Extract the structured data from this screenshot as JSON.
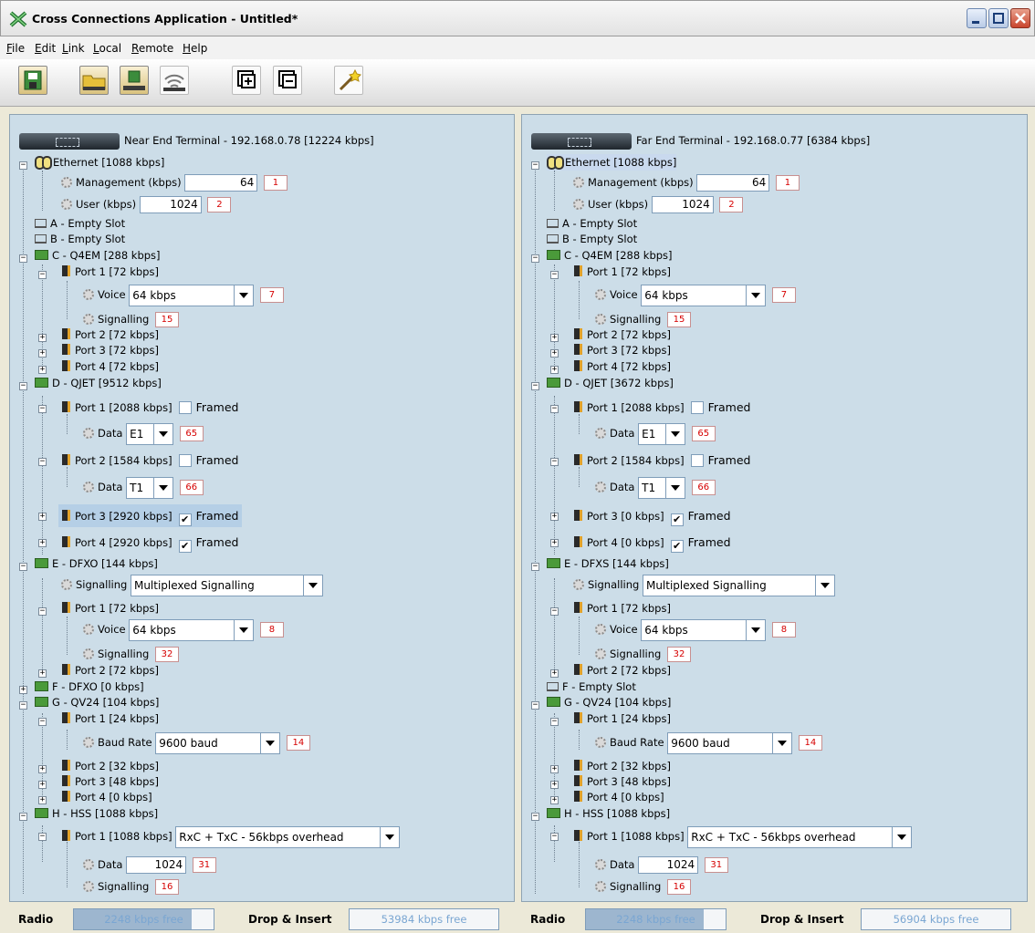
{
  "window": {
    "title": "Cross Connections Application - Untitled*"
  },
  "menu": [
    "File",
    "Edit",
    "Link",
    "Local",
    "Remote",
    "Help"
  ],
  "toolbar": {
    "icons": [
      "save-icon",
      "open-folder-icon",
      "download-icon",
      "antenna-icon",
      "expand-all-icon",
      "collapse-all-icon",
      "wizard-wand-icon"
    ]
  },
  "near": {
    "header": "Near End Terminal - 192.168.0.78 [12224 kbps]",
    "ethernet": "Ethernet [1088 kbps]",
    "mgmt_label": "Management (kbps)",
    "mgmt_value": "64",
    "mgmt_tag": "1",
    "user_label": "User (kbps)",
    "user_value": "1024",
    "user_tag": "2",
    "slot_a": "A - Empty Slot",
    "slot_b": "B - Empty Slot",
    "c_card": "C - Q4EM [288 kbps]",
    "c_p1": "Port 1 [72 kbps]",
    "c_voice": "Voice",
    "c_voice_val": "64 kbps",
    "c_voice_tag": "7",
    "c_sig": "Signalling",
    "c_sig_tag": "15",
    "c_p2": "Port 2 [72 kbps]",
    "c_p3": "Port 3 [72 kbps]",
    "c_p4": "Port 4 [72 kbps]",
    "d_card": "D - QJET [9512 kbps]",
    "d_p1": "Port 1 [2088 kbps]",
    "framed": "Framed",
    "data": "Data",
    "d_p1_val": "E1",
    "d_p1_tag": "65",
    "d_p2": "Port 2 [1584 kbps]",
    "d_p2_val": "T1",
    "d_p2_tag": "66",
    "d_p3": "Port 3 [2920 kbps]",
    "d_p4": "Port 4 [2920 kbps]",
    "e_card": "E - DFXO [144 kbps]",
    "e_sig": "Signalling",
    "e_sig_val": "Multiplexed Signalling",
    "e_p1": "Port 1 [72 kbps]",
    "e_voice": "Voice",
    "e_voice_val": "64 kbps",
    "e_voice_tag": "8",
    "e_p1sig": "Signalling",
    "e_p1sig_tag": "32",
    "e_p2": "Port 2 [72 kbps]",
    "f_card": "F - DFXO [0 kbps]",
    "g_card": "G - QV24 [104 kbps]",
    "g_p1": "Port 1 [24 kbps]",
    "g_baud": "Baud Rate",
    "g_baud_val": "9600 baud",
    "g_baud_tag": "14",
    "g_p2": "Port 2 [32 kbps]",
    "g_p3": "Port 3 [48 kbps]",
    "g_p4": "Port 4 [0 kbps]",
    "h_card": "H - HSS [1088 kbps]",
    "h_p1": "Port 1 [1088 kbps]",
    "h_p1_val": "RxC + TxC - 56kbps overhead",
    "h_data": "Data",
    "h_data_val": "1024",
    "h_data_tag": "31",
    "h_sig": "Signalling",
    "h_sig_tag": "16"
  },
  "far": {
    "header": "Far End Terminal - 192.168.0.77 [6384 kbps]",
    "ethernet": "Ethernet [1088 kbps]",
    "mgmt_label": "Management (kbps)",
    "mgmt_value": "64",
    "mgmt_tag": "1",
    "user_label": "User (kbps)",
    "user_value": "1024",
    "user_tag": "2",
    "slot_a": "A - Empty Slot",
    "slot_b": "B - Empty Slot",
    "c_card": "C - Q4EM [288 kbps]",
    "c_p1": "Port 1 [72 kbps]",
    "c_voice": "Voice",
    "c_voice_val": "64 kbps",
    "c_voice_tag": "7",
    "c_sig": "Signalling",
    "c_sig_tag": "15",
    "c_p2": "Port 2 [72 kbps]",
    "c_p3": "Port 3 [72 kbps]",
    "c_p4": "Port 4 [72 kbps]",
    "d_card": "D - QJET [3672 kbps]",
    "d_p1": "Port 1 [2088 kbps]",
    "framed": "Framed",
    "data": "Data",
    "d_p1_val": "E1",
    "d_p1_tag": "65",
    "d_p2": "Port 2 [1584 kbps]",
    "d_p2_val": "T1",
    "d_p2_tag": "66",
    "d_p3": "Port 3 [0 kbps]",
    "d_p4": "Port 4 [0 kbps]",
    "e_card": "E - DFXS [144 kbps]",
    "e_sig": "Signalling",
    "e_sig_val": "Multiplexed Signalling",
    "e_p1": "Port 1 [72 kbps]",
    "e_voice": "Voice",
    "e_voice_val": "64 kbps",
    "e_voice_tag": "8",
    "e_p1sig": "Signalling",
    "e_p1sig_tag": "32",
    "e_p2": "Port 2 [72 kbps]",
    "f_slot": "F - Empty Slot",
    "g_card": "G - QV24 [104 kbps]",
    "g_p1": "Port 1 [24 kbps]",
    "g_baud": "Baud Rate",
    "g_baud_val": "9600 baud",
    "g_baud_tag": "14",
    "g_p2": "Port 2 [32 kbps]",
    "g_p3": "Port 3 [48 kbps]",
    "g_p4": "Port 4 [0 kbps]",
    "h_card": "H - HSS [1088 kbps]",
    "h_p1": "Port 1 [1088 kbps]",
    "h_p1_val": "RxC + TxC - 56kbps overhead",
    "h_data": "Data",
    "h_data_val": "1024",
    "h_data_tag": "31",
    "h_sig": "Signalling",
    "h_sig_tag": "16"
  },
  "status": {
    "near": {
      "radio_label": "Radio",
      "radio_value": "2248 kbps free",
      "radio_used_fraction": 0.84,
      "di_label": "Drop & Insert",
      "di_value": "53984 kbps free"
    },
    "far": {
      "radio_label": "Radio",
      "radio_value": "2248 kbps free",
      "radio_used_fraction": 0.84,
      "di_label": "Drop & Insert",
      "di_value": "56904 kbps free"
    }
  }
}
